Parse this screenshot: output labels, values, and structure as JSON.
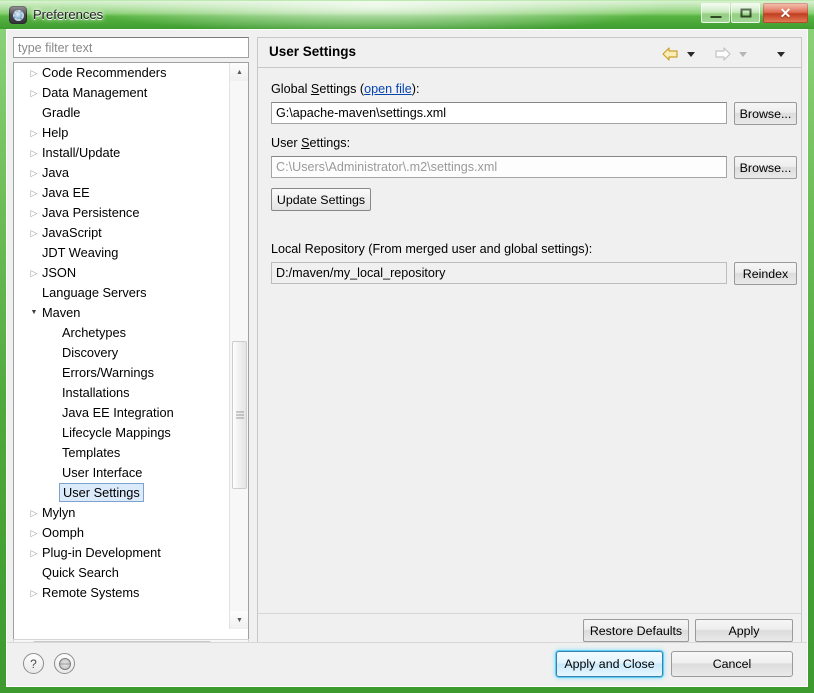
{
  "window": {
    "title": "Preferences",
    "icon": "preferences-gear-icon",
    "controls": {
      "minimize": "Minimize",
      "maximize": "Maximize",
      "close": "Close"
    }
  },
  "sidebar": {
    "filter": {
      "placeholder": "type filter text",
      "value": ""
    },
    "items": [
      {
        "label": "Code Recommenders",
        "level": 0,
        "expandable": true,
        "expanded": false,
        "selected": false
      },
      {
        "label": "Data Management",
        "level": 0,
        "expandable": true,
        "expanded": false,
        "selected": false
      },
      {
        "label": "Gradle",
        "level": 0,
        "expandable": false,
        "expanded": false,
        "selected": false
      },
      {
        "label": "Help",
        "level": 0,
        "expandable": true,
        "expanded": false,
        "selected": false
      },
      {
        "label": "Install/Update",
        "level": 0,
        "expandable": true,
        "expanded": false,
        "selected": false
      },
      {
        "label": "Java",
        "level": 0,
        "expandable": true,
        "expanded": false,
        "selected": false
      },
      {
        "label": "Java EE",
        "level": 0,
        "expandable": true,
        "expanded": false,
        "selected": false
      },
      {
        "label": "Java Persistence",
        "level": 0,
        "expandable": true,
        "expanded": false,
        "selected": false
      },
      {
        "label": "JavaScript",
        "level": 0,
        "expandable": true,
        "expanded": false,
        "selected": false
      },
      {
        "label": "JDT Weaving",
        "level": 0,
        "expandable": false,
        "expanded": false,
        "selected": false
      },
      {
        "label": "JSON",
        "level": 0,
        "expandable": true,
        "expanded": false,
        "selected": false
      },
      {
        "label": "Language Servers",
        "level": 0,
        "expandable": false,
        "expanded": false,
        "selected": false
      },
      {
        "label": "Maven",
        "level": 0,
        "expandable": true,
        "expanded": true,
        "selected": false
      },
      {
        "label": "Archetypes",
        "level": 1,
        "expandable": false,
        "expanded": false,
        "selected": false
      },
      {
        "label": "Discovery",
        "level": 1,
        "expandable": false,
        "expanded": false,
        "selected": false
      },
      {
        "label": "Errors/Warnings",
        "level": 1,
        "expandable": false,
        "expanded": false,
        "selected": false
      },
      {
        "label": "Installations",
        "level": 1,
        "expandable": false,
        "expanded": false,
        "selected": false
      },
      {
        "label": "Java EE Integration",
        "level": 1,
        "expandable": false,
        "expanded": false,
        "selected": false
      },
      {
        "label": "Lifecycle Mappings",
        "level": 1,
        "expandable": false,
        "expanded": false,
        "selected": false
      },
      {
        "label": "Templates",
        "level": 1,
        "expandable": false,
        "expanded": false,
        "selected": false
      },
      {
        "label": "User Interface",
        "level": 1,
        "expandable": false,
        "expanded": false,
        "selected": false
      },
      {
        "label": "User Settings",
        "level": 1,
        "expandable": false,
        "expanded": false,
        "selected": true
      },
      {
        "label": "Mylyn",
        "level": 0,
        "expandable": true,
        "expanded": false,
        "selected": false
      },
      {
        "label": "Oomph",
        "level": 0,
        "expandable": true,
        "expanded": false,
        "selected": false
      },
      {
        "label": "Plug-in Development",
        "level": 0,
        "expandable": true,
        "expanded": false,
        "selected": false
      },
      {
        "label": "Quick Search",
        "level": 0,
        "expandable": false,
        "expanded": false,
        "selected": false
      },
      {
        "label": "Remote Systems",
        "level": 0,
        "expandable": true,
        "expanded": false,
        "selected": false
      }
    ],
    "scrollbar_vertical": {
      "up": "▲",
      "down": "▼"
    },
    "scrollbar_horizontal": {
      "left": "◄",
      "right": "►"
    }
  },
  "content": {
    "title": "User Settings",
    "nav": {
      "back": "back-arrow-icon",
      "back_menu": "back-dropdown-icon",
      "forward": "forward-arrow-icon",
      "forward_menu": "forward-dropdown-icon",
      "view_menu": "view-menu-icon"
    },
    "global_settings": {
      "label_before": "Global ",
      "label_mnemonic": "S",
      "label_after": "ettings (",
      "link": "open file",
      "label_end": "):",
      "value": "G:\\apache-maven\\settings.xml",
      "browse_label": "Browse..."
    },
    "user_settings": {
      "label_before": "User ",
      "label_mnemonic": "S",
      "label_after": "ettings:",
      "value": "C:\\Users\\Administrator\\.m2\\settings.xml",
      "browse_label": "Browse...",
      "update_label": "Update Settings"
    },
    "local_repository": {
      "label": "Local Repository (From merged user and global settings):",
      "value": "D:/maven/my_local_repository",
      "reindex_label": "Reindex"
    },
    "restore_defaults_label": "Restore Defaults",
    "apply_label": "Apply"
  },
  "footer": {
    "help_icon": "?",
    "globe_icon": "globe-icon",
    "apply_and_close_label": "Apply and Close",
    "cancel_label": "Cancel"
  },
  "colors": {
    "frame_green": "#4fa83c",
    "link_blue": "#0645ad",
    "selection_blue": "#dcebfb",
    "default_button_glow": "#5fd0f5",
    "close_red": "#d9563a"
  }
}
